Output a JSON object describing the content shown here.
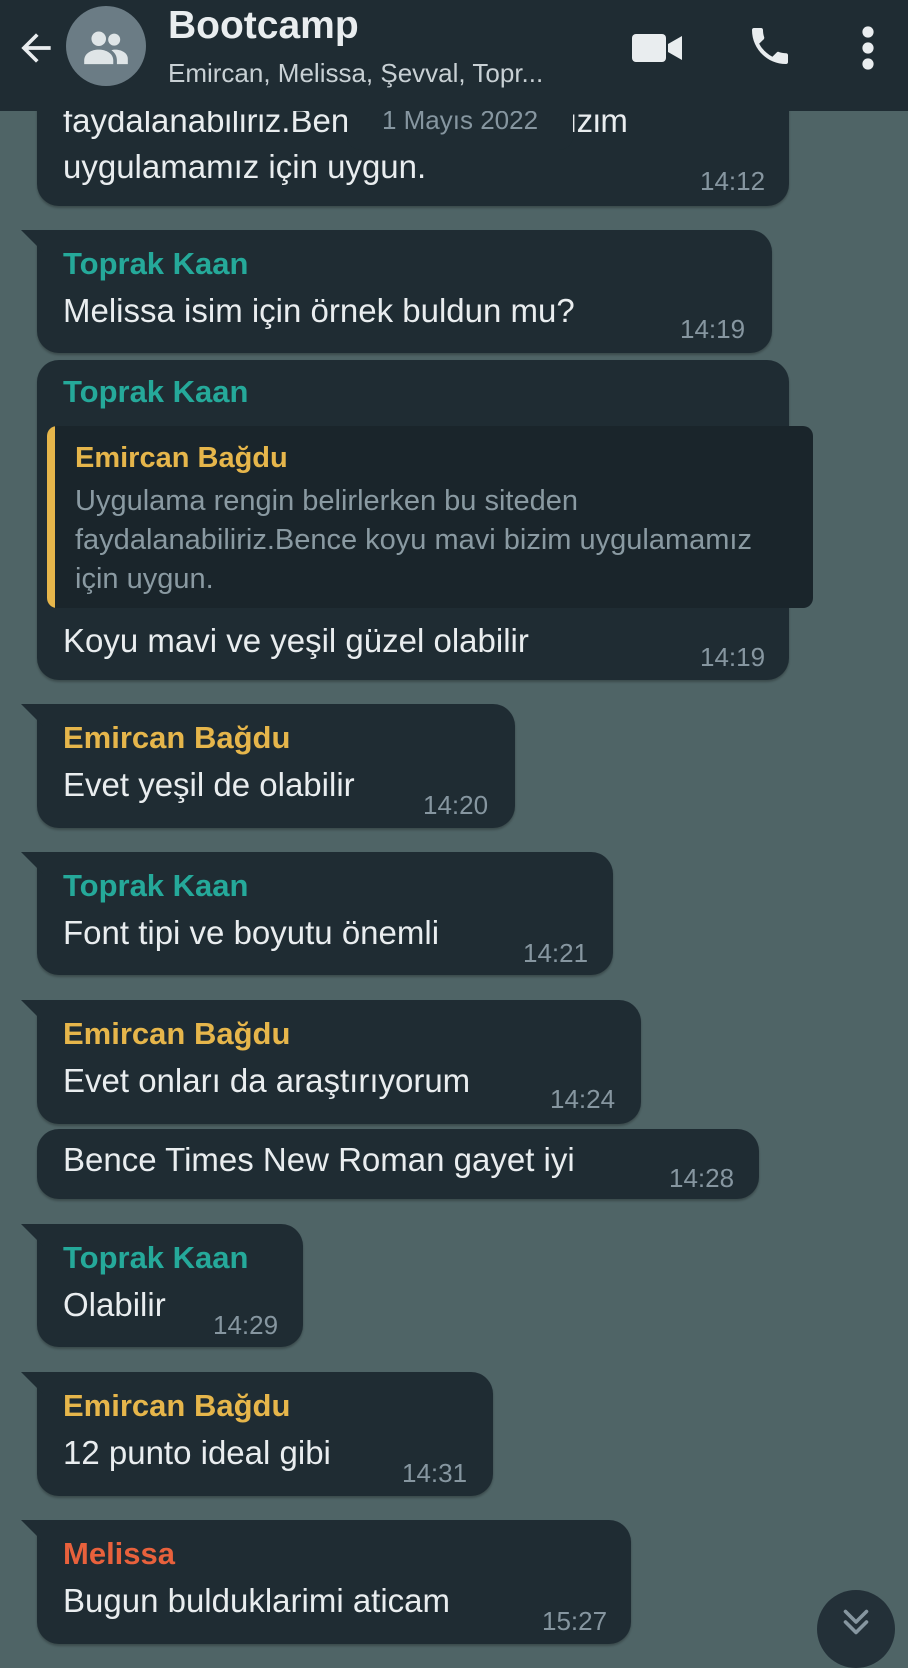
{
  "header": {
    "title": "Bootcamp",
    "subtitle": "Emircan, Melissa, Şevval, Topr...",
    "icons": [
      "back-arrow-icon",
      "group-avatar-icon",
      "video-call-icon",
      "phone-icon",
      "more-vert-icon"
    ]
  },
  "date_chip": "1 Mayıs 2022",
  "colors": {
    "appbar": "#1f2c33",
    "background": "#4f6466",
    "bubble": "#1f2c33",
    "toprak": "#25a99a",
    "emircan": "#e6b64b",
    "melissa": "#e8613c"
  },
  "messages": [
    {
      "sender": "",
      "lines": [
        "faydalanabiliriz.Bence koyu mavi bizim",
        "uygulamamız için uygun."
      ],
      "time": "14:12"
    },
    {
      "sender": "Toprak Kaan",
      "text": "Melissa isim için örnek buldun mu?",
      "time": "14:19"
    },
    {
      "sender": "Toprak Kaan",
      "quote": {
        "sender": "Emircan Bağdu",
        "text": "Uygulama rengin belirlerken bu siteden faydalanabiliriz.Bence koyu mavi bizim uygulamamız için uygun."
      },
      "text": "Koyu mavi ve yeşil güzel olabilir",
      "time": "14:19"
    },
    {
      "sender": "Emircan Bağdu",
      "text": "Evet yeşil de olabilir",
      "time": "14:20"
    },
    {
      "sender": "Toprak Kaan",
      "text": "Font tipi ve boyutu önemli",
      "time": "14:21"
    },
    {
      "sender": "Emircan Bağdu",
      "text": "Evet onları da araştırıyorum",
      "time": "14:24"
    },
    {
      "sender": "",
      "text": "Bence Times New Roman gayet iyi",
      "time": "14:28"
    },
    {
      "sender": "Toprak Kaan",
      "text": "Olabilir",
      "time": "14:29"
    },
    {
      "sender": "Emircan Bağdu",
      "text": "12 punto ideal gibi",
      "time": "14:31"
    },
    {
      "sender": "Melissa",
      "text": "Bugun bulduklarimi aticam",
      "time": "15:27"
    }
  ]
}
